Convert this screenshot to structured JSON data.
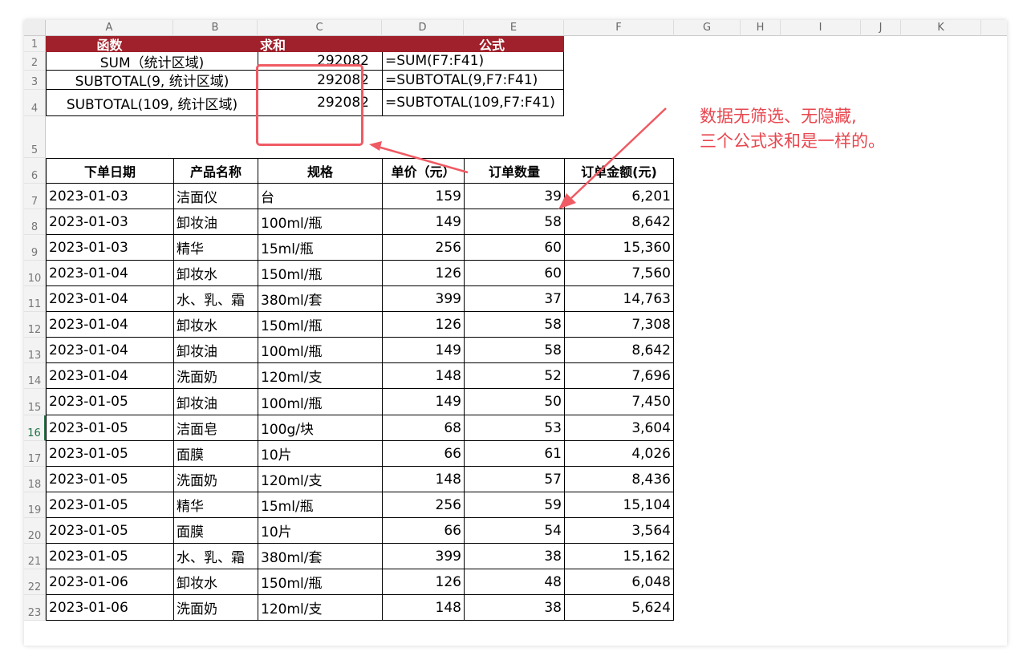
{
  "column_headers": [
    "A",
    "B",
    "C",
    "D",
    "E",
    "F",
    "G",
    "H",
    "I",
    "J",
    "K"
  ],
  "row_numbers": [
    "1",
    "2",
    "3",
    "4",
    "5",
    "6",
    "7",
    "8",
    "9",
    "10",
    "11",
    "12",
    "13",
    "14",
    "15",
    "16",
    "17",
    "18",
    "19",
    "20",
    "21",
    "22",
    "23"
  ],
  "summary": {
    "headers": {
      "func": "函数",
      "sum": "求和",
      "formula": "公式"
    },
    "rows": [
      {
        "func": "SUM（统计区域)",
        "sum": "292082",
        "formula": "=SUM(F7:F41)"
      },
      {
        "func": "SUBTOTAL(9, 统计区域)",
        "sum": "292082",
        "formula": "=SUBTOTAL(9,F7:F41)"
      },
      {
        "func": "SUBTOTAL(109, 统计区域)",
        "sum": "292082",
        "formula": "=SUBTOTAL(109,F7:F41)"
      }
    ]
  },
  "annotation": {
    "line1": "数据无筛选、无隐藏,",
    "line2": "三个公式求和是一样的。",
    "accent_color": "#e8474f"
  },
  "table": {
    "headers": [
      "下单日期",
      "产品名称",
      "规格",
      "单价（元）",
      "订单数量",
      "订单金额(元)"
    ],
    "rows": [
      [
        "2023-01-03",
        "洁面仪",
        "台",
        "159",
        "39",
        "6,201"
      ],
      [
        "2023-01-03",
        "卸妆油",
        "100ml/瓶",
        "149",
        "58",
        "8,642"
      ],
      [
        "2023-01-03",
        "精华",
        "15ml/瓶",
        "256",
        "60",
        "15,360"
      ],
      [
        "2023-01-04",
        "卸妆水",
        "150ml/瓶",
        "126",
        "60",
        "7,560"
      ],
      [
        "2023-01-04",
        "水、乳、霜",
        "380ml/套",
        "399",
        "37",
        "14,763"
      ],
      [
        "2023-01-04",
        "卸妆水",
        "150ml/瓶",
        "126",
        "58",
        "7,308"
      ],
      [
        "2023-01-04",
        "卸妆油",
        "100ml/瓶",
        "149",
        "58",
        "8,642"
      ],
      [
        "2023-01-04",
        "洗面奶",
        "120ml/支",
        "148",
        "52",
        "7,696"
      ],
      [
        "2023-01-05",
        "卸妆油",
        "100ml/瓶",
        "149",
        "50",
        "7,450"
      ],
      [
        "2023-01-05",
        "洁面皂",
        "100g/块",
        "68",
        "53",
        "3,604"
      ],
      [
        "2023-01-05",
        "面膜",
        "10片",
        "66",
        "61",
        "4,026"
      ],
      [
        "2023-01-05",
        "洗面奶",
        "120ml/支",
        "148",
        "57",
        "8,436"
      ],
      [
        "2023-01-05",
        "精华",
        "15ml/瓶",
        "256",
        "59",
        "15,104"
      ],
      [
        "2023-01-05",
        "面膜",
        "10片",
        "66",
        "54",
        "3,564"
      ],
      [
        "2023-01-05",
        "水、乳、霜",
        "380ml/套",
        "399",
        "38",
        "15,162"
      ],
      [
        "2023-01-06",
        "卸妆水",
        "150ml/瓶",
        "126",
        "48",
        "6,048"
      ],
      [
        "2023-01-06",
        "洗面奶",
        "120ml/支",
        "148",
        "38",
        "5,624"
      ]
    ]
  },
  "selected_row": "16",
  "header_fill_color": "#a0212b"
}
